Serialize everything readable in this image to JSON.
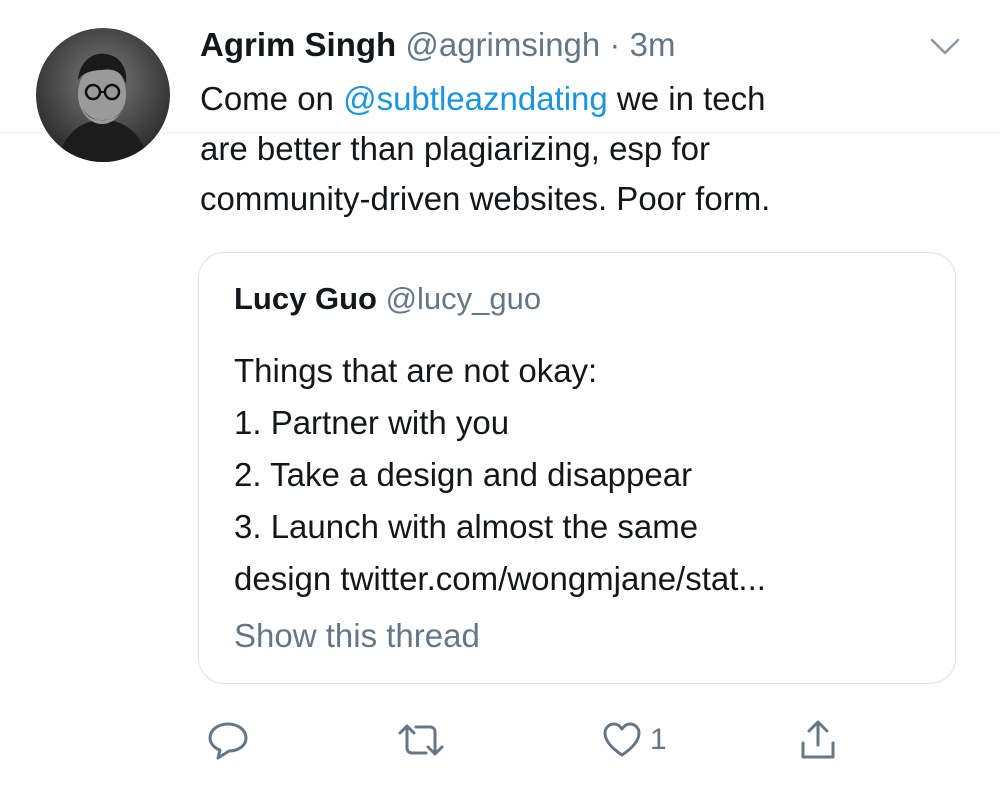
{
  "tweet": {
    "author_name": "Agrim Singh",
    "author_handle": "@agrimsingh",
    "separator": "·",
    "time": "3m",
    "text_prefix": "Come on ",
    "mention": "@subtleazndating",
    "text_line1_rest": " we in tech",
    "text_line2": "are better than plagiarizing, esp for",
    "text_line3": "community-driven websites. Poor form."
  },
  "quoted_tweet": {
    "author_name": "Lucy Guo",
    "author_handle": "@lucy_guo",
    "lines": [
      "Things that are not okay:",
      "1. Partner with you",
      "2. Take a design and disappear",
      "3. Launch with almost the same",
      "design twitter.com/wongmjane/stat..."
    ],
    "show_thread": "Show this thread"
  },
  "actions": {
    "like_count": "1",
    "icons": [
      "reply-icon",
      "retweet-icon",
      "like-icon",
      "share-icon"
    ]
  },
  "colors": {
    "text": "#14171a",
    "muted": "#657786",
    "link": "#1b95e0",
    "border": "#dde3e8"
  }
}
